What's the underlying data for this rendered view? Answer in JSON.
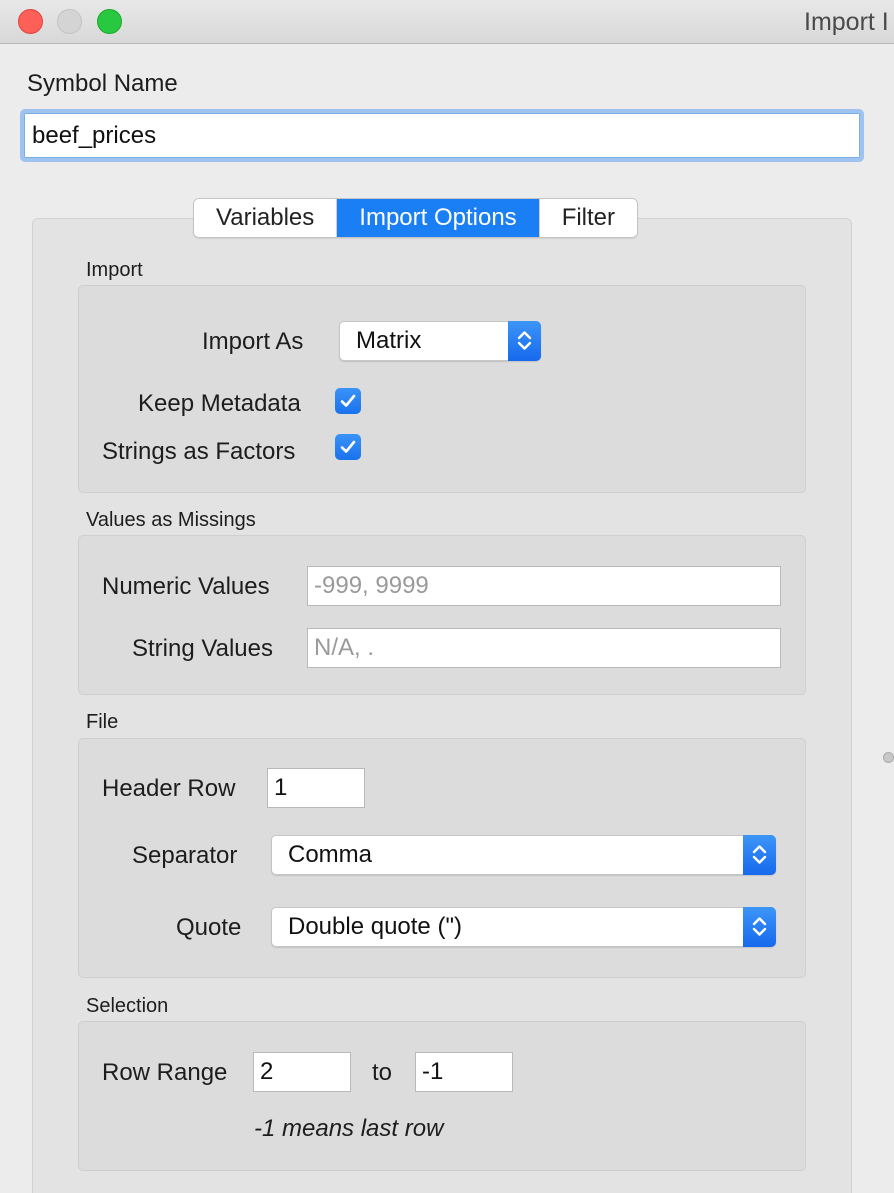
{
  "window": {
    "title": "Import I"
  },
  "symbol": {
    "label": "Symbol Name",
    "value": "beef_prices"
  },
  "tabs": [
    {
      "label": "Variables",
      "active": false
    },
    {
      "label": "Import Options",
      "active": true
    },
    {
      "label": "Filter",
      "active": false
    }
  ],
  "import_group": {
    "title": "Import",
    "import_as_label": "Import As",
    "import_as_value": "Matrix",
    "keep_metadata_label": "Keep Metadata",
    "keep_metadata_checked": true,
    "strings_as_factors_label": "Strings as Factors",
    "strings_as_factors_checked": true
  },
  "missings_group": {
    "title": "Values as Missings",
    "numeric_label": "Numeric Values",
    "numeric_placeholder": "-999, 9999",
    "string_label": "String Values",
    "string_placeholder": "N/A, ."
  },
  "file_group": {
    "title": "File",
    "header_row_label": "Header Row",
    "header_row_value": "1",
    "separator_label": "Separator",
    "separator_value": "Comma",
    "quote_label": "Quote",
    "quote_value": "Double quote (\")"
  },
  "selection_group": {
    "title": "Selection",
    "row_range_label": "Row Range",
    "row_from": "2",
    "to_label": "to",
    "row_to": "-1",
    "hint": "-1 means last row"
  },
  "colors": {
    "accent": "#1a7ef5",
    "focus_ring": "#9fc3ef"
  }
}
